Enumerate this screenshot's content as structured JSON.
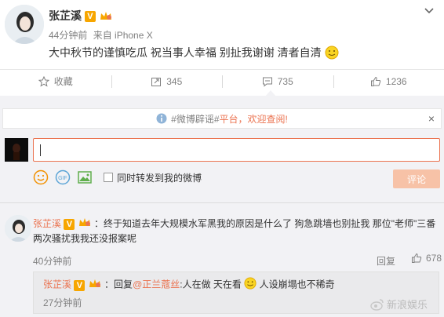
{
  "post": {
    "author": "张芷溪",
    "time": "44分钟前",
    "source": "来自 iPhone X",
    "text": "大中秋节的谨慎吃瓜 祝当事人幸福 别扯我谢谢 清者自清"
  },
  "actions": {
    "favorite": "收藏",
    "repost": "345",
    "comment": "735",
    "like": "1236"
  },
  "notice": {
    "tag": "#微博辟谣#",
    "text": "平台，欢迎查阅!",
    "close": "×"
  },
  "composer": {
    "repost_label": "同时转发到我的微博",
    "submit_label": "评论"
  },
  "comment": {
    "author": "张芷溪",
    "text": "：终于知道去年大规模水军黑我的原因是什么了 狗急跳墙也别扯我 那位\"老师\"三番两次骚扰我我还没报案呢",
    "time": "40分钟前",
    "reply_label": "回复",
    "likes": "678",
    "sub_reply": {
      "author": "张芷溪",
      "prefix": "：回复",
      "mention": "@正兰蔻丝",
      "text_a": ":人在做 天在看",
      "text_b": " 人设崩塌也不稀奇",
      "time": "27分钟前"
    }
  },
  "watermark": "新浪娱乐",
  "colors": {
    "accent": "#eb7350",
    "badge": "#f7a600",
    "submit_disabled": "#f7c2a7"
  }
}
